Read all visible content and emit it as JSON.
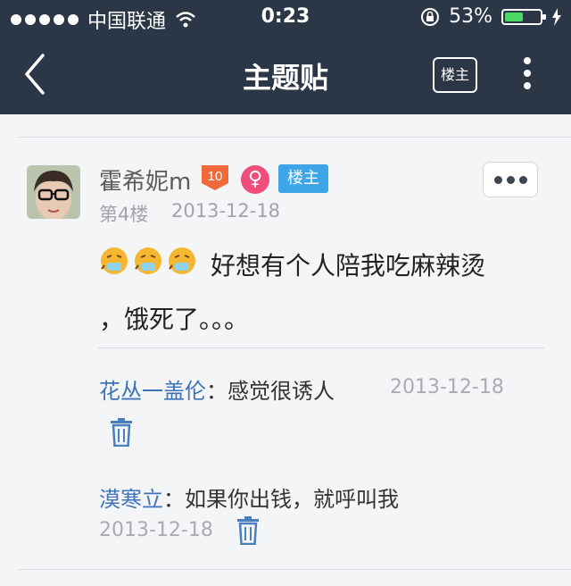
{
  "status_bar": {
    "carrier": "中国联通",
    "time": "0:23",
    "battery_percent": "53%",
    "battery_level": 0.53
  },
  "nav": {
    "title": "主题贴",
    "owner_button_label": "楼主"
  },
  "post": {
    "username": "霍希妮m",
    "level": "10",
    "gender_symbol": "♀",
    "badge": "楼主",
    "floor": "第4楼",
    "date": "2013-12-18",
    "emoji_count": 3,
    "content_line1": "好想有个人陪我吃麻辣烫",
    "content_line2": "，饿死了。。。"
  },
  "comments": [
    {
      "user": "花丛一盖伦",
      "text": "：感觉很诱人",
      "date": "2013-12-18"
    },
    {
      "user": "漠寒立",
      "text": "：如果你出钱，就呼叫我",
      "date": "2013-12-18"
    }
  ],
  "colors": {
    "nav_bg": "#2b3646",
    "page_bg": "#f4f5f7",
    "link_blue": "#3d73b8",
    "badge_blue": "#3ea5e6",
    "level_orange": "#f06a3b",
    "gender_pink": "#f04d7b"
  }
}
